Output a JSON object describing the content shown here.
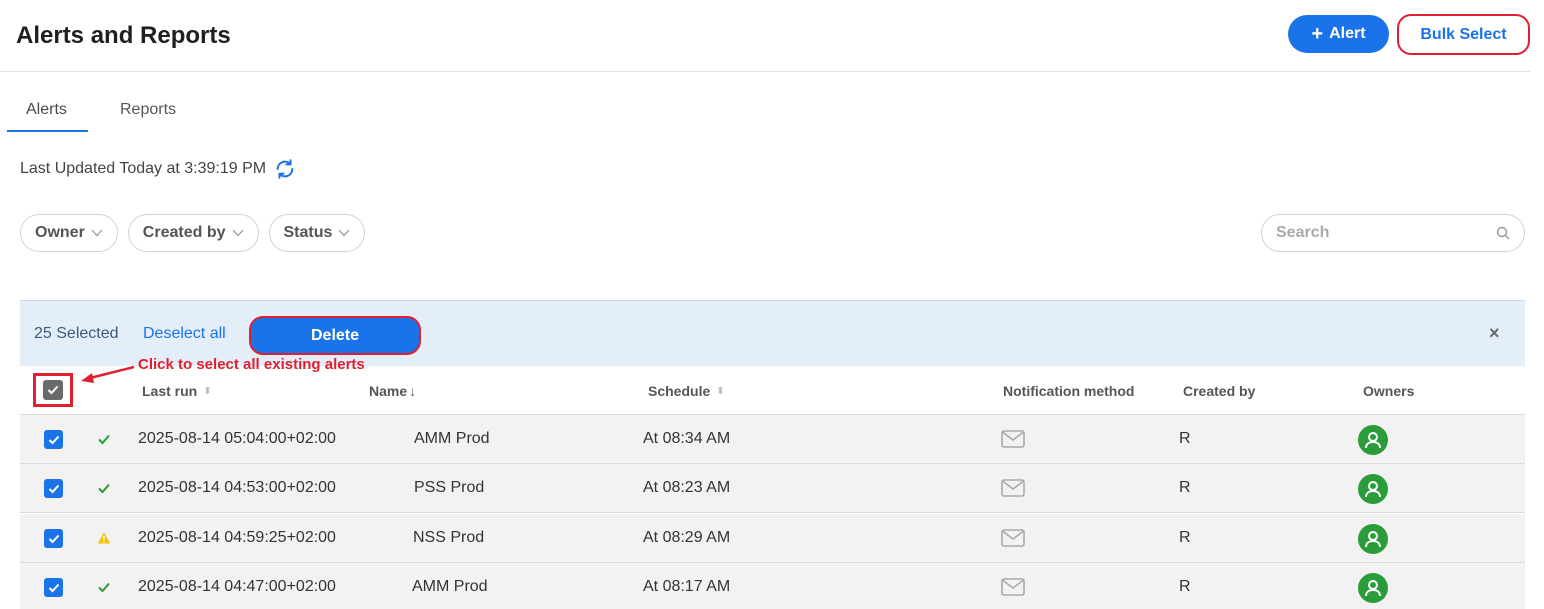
{
  "header": {
    "title": "Alerts and Reports",
    "alert_button": "Alert",
    "bulk_select_button": "Bulk Select"
  },
  "tabs": [
    {
      "label": "Alerts",
      "active": true
    },
    {
      "label": "Reports",
      "active": false
    }
  ],
  "last_updated": "Last Updated Today at 3:39:19 PM",
  "filters": {
    "owner": "Owner",
    "created_by": "Created by",
    "status": "Status"
  },
  "search": {
    "placeholder": "Search"
  },
  "bulk_bar": {
    "selected": "25 Selected",
    "deselect_all": "Deselect all",
    "delete": "Delete",
    "close": "×"
  },
  "annotation": "Click to select all existing alerts",
  "columns": {
    "last_run": "Last run",
    "name": "Name",
    "schedule": "Schedule",
    "notification": "Notification method",
    "created_by": "Created by",
    "owners": "Owners"
  },
  "rows": [
    {
      "checked": true,
      "status": "success",
      "last_run": "2025-08-14 05:04:00+02:00",
      "name": "AMM Prod",
      "schedule": "At 08:34 AM",
      "notification": "email-icon",
      "created_by": "R"
    },
    {
      "checked": true,
      "status": "success",
      "last_run": "2025-08-14 04:53:00+02:00",
      "name": "PSS Prod",
      "schedule": "At 08:23 AM",
      "notification": "email-icon",
      "created_by": "R"
    },
    {
      "checked": true,
      "status": "warning",
      "last_run": "2025-08-14 04:59:25+02:00",
      "name": "NSS Prod",
      "schedule": "At 08:29 AM",
      "notification": "email-icon",
      "created_by": "R"
    },
    {
      "checked": true,
      "status": "success",
      "last_run": "2025-08-14 04:47:00+02:00",
      "name": "AMM Prod",
      "schedule": "At 08:17 AM",
      "notification": "email-icon",
      "created_by": "R"
    }
  ],
  "colors": {
    "primary": "#1a73e8",
    "highlight": "#e02030",
    "success": "#2a9d3a",
    "warning": "#f2c200",
    "bulk_bar_bg": "#e4eef9"
  }
}
